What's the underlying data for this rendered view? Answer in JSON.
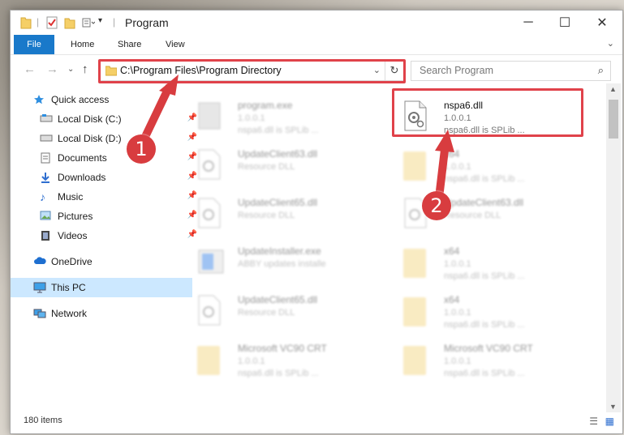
{
  "window": {
    "title": "Program"
  },
  "ribbon": {
    "tabs": [
      "File",
      "Home",
      "Share",
      "View"
    ]
  },
  "address": {
    "path": "C:\\Program Files\\Program Directory"
  },
  "search": {
    "placeholder": "Search Program"
  },
  "sidebar": {
    "items": [
      {
        "label": "Quick access",
        "icon": "star-icon",
        "pinned": false
      },
      {
        "label": "Local Disk (C:)",
        "icon": "drive-icon",
        "pinned": true
      },
      {
        "label": "Local Disk (D:)",
        "icon": "drive-icon",
        "pinned": true
      },
      {
        "label": "Documents",
        "icon": "documents-icon",
        "pinned": true
      },
      {
        "label": "Downloads",
        "icon": "download-icon",
        "pinned": true
      },
      {
        "label": "Music",
        "icon": "music-icon",
        "pinned": true
      },
      {
        "label": "Pictures",
        "icon": "pictures-icon",
        "pinned": true
      },
      {
        "label": "Videos",
        "icon": "videos-icon",
        "pinned": true
      },
      {
        "label": "OneDrive",
        "icon": "cloud-icon",
        "pinned": false
      },
      {
        "label": "This PC",
        "icon": "computer-icon",
        "pinned": false,
        "selected": true
      },
      {
        "label": "Network",
        "icon": "network-icon",
        "pinned": false
      }
    ]
  },
  "files": [
    {
      "name": "program.exe",
      "version": "1.0.0.1",
      "desc": "nspa6.dll is SPLib ...",
      "type": "exe"
    },
    {
      "name": "nspa6.dll",
      "version": "1.0.0.1",
      "desc": "nspa6.dll is SPLib ...",
      "type": "dll",
      "highlighted": true
    },
    {
      "name": "UpdateClient63.dll",
      "version": "Resource DLL",
      "desc": "",
      "type": "dll"
    },
    {
      "name": "x64",
      "version": "1.0.0.1",
      "desc": "nspa6.dll is SPLib ...",
      "type": "folder"
    },
    {
      "name": "UpdateClient65.dll",
      "version": "Resource DLL",
      "desc": "",
      "type": "dll"
    },
    {
      "name": "UpdateClient63.dll",
      "version": "Resource DLL",
      "desc": "",
      "type": "dll"
    },
    {
      "name": "UpdateInstaller.exe",
      "version": "ABBY updates installe",
      "desc": "",
      "type": "installer"
    },
    {
      "name": "x64",
      "version": "1.0.0.1",
      "desc": "nspa6.dll is SPLib ...",
      "type": "folder"
    },
    {
      "name": "UpdateClient65.dll",
      "version": "Resource DLL",
      "desc": "",
      "type": "dll"
    },
    {
      "name": "x64",
      "version": "1.0.0.1",
      "desc": "nspa6.dll is SPLib ...",
      "type": "folder"
    },
    {
      "name": "Microsoft VC90 CRT",
      "version": "1.0.0.1",
      "desc": "nspa6.dll is SPLib ...",
      "type": "folder"
    },
    {
      "name": "Microsoft VC90 CRT",
      "version": "1.0.0.1",
      "desc": "nspa6.dll is SPLib ...",
      "type": "folder"
    }
  ],
  "status": {
    "item_count": "180 items"
  },
  "annotations": {
    "step1": "1",
    "step2": "2"
  },
  "colors": {
    "accent": "#1979ca",
    "highlight": "#e0424a",
    "badge": "#d83c3f",
    "selected": "#cce8ff"
  }
}
